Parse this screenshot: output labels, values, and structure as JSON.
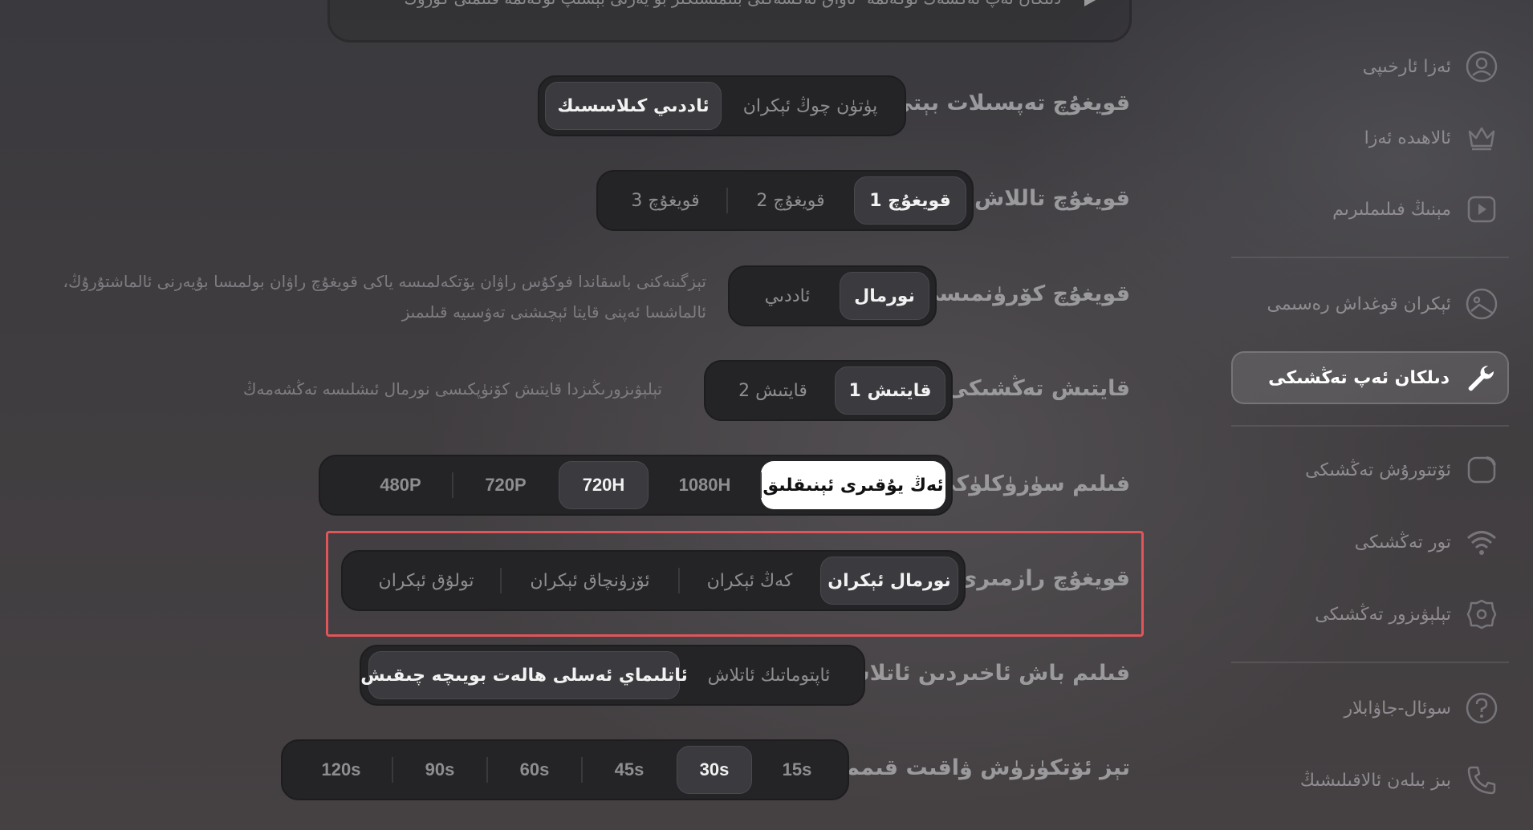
{
  "top": {
    "text": "دىلكان ئەپ تەڭشەك توكەنمە- ئاۋاق تەڭشەكنى بىلمىسىڭىز بو يەرنى بېسىپ توكەنمە قىلمنى كوروك"
  },
  "rows": {
    "subtitle_style": {
      "label": "قويغۇچ تەپسىلات بېتى",
      "options": [
        "پۈتۈن چوڭ ئېكران",
        "ئاددىي كىلاسسىك"
      ]
    },
    "player_select": {
      "label": "قويغۇچ تاللاش",
      "options": [
        "قويغۇچ 1",
        "قويغۇچ 2",
        "قويغۇچ 3"
      ]
    },
    "player_look": {
      "label": "قويغۇچ كۆرۈنمىسى",
      "options": [
        "نورمال",
        "ئاددىي"
      ],
      "note_line1": "تېزگىنەكنى باسقاندا فوكۇس راۋان يۆتكەلمىسە ياكى قويغۇچ راۋان بولمىسا بۇيەرنى ئالماشتۇرۇڭ،",
      "note_line2": "ئالماشسا ئەپنى قايتا ئېچىشنى تەۋسىيە قىلىمىز"
    },
    "decode_setting": {
      "label": "قايتىش تەڭشىكى",
      "options": [
        "قايتىش 1",
        "قايتىش 2"
      ],
      "note": "تېلېۋىزورىڭىزدا قايتىش كۆنۈپكىسى نورمال ئىشلىسە تەڭشەمەڭ"
    },
    "resolution": {
      "label": "فىلىم سۈزۈكلۈكى",
      "options": [
        "ئەڭ يۇقىرى ئېنىقلىق",
        "1080H",
        "720H",
        "720P",
        "480P"
      ]
    },
    "player_ratio": {
      "label": "قويغۇچ رازمىرى",
      "options": [
        "نورمال ئېكران",
        "كەڭ ئېكران",
        "ئۆزۈنچاق ئېكران",
        "تولۇق ئېكران"
      ]
    },
    "start_pos": {
      "label": "فىلىم باش ئاخىردىن ئاتلاش",
      "options": [
        "ئاپتوماتىك ئاتلاش",
        "ئاتلىماي ئەسلى ھالەت بويىچە چىقىش"
      ]
    },
    "fast_forward": {
      "label": "تېز ئۆتكۈزۈش ۋاقىت قىممىتى",
      "options": [
        "15s",
        "30s",
        "45s",
        "60s",
        "90s",
        "120s"
      ]
    }
  },
  "sidebar": {
    "items": [
      {
        "label": "ئەزا ئارخىپى",
        "icon": "user-icon"
      },
      {
        "label": "ئالاھىدە ئەزا",
        "icon": "crown-icon"
      },
      {
        "label": "مېنىڭ فىلىملىرىم",
        "icon": "play-square-icon"
      },
      {
        "label": "ئېكران قوغداش رەسىمى",
        "icon": "image-icon"
      },
      {
        "label": "دىلكان ئەپ تەڭشىكى",
        "icon": "wrench-icon"
      },
      {
        "label": "ئۆتتورۇش تەڭشىكى",
        "icon": "rotate-icon"
      },
      {
        "label": "تور تەڭشىكى",
        "icon": "wifi-icon"
      },
      {
        "label": "تېلېۋىزور تەڭشىكى",
        "icon": "gear-icon"
      },
      {
        "label": "سوئال-جاۋابلار",
        "icon": "question-icon"
      },
      {
        "label": "بىز بىلەن ئالاقىلىشىڭ",
        "icon": "phone-icon"
      }
    ]
  },
  "colors": {
    "highlight": "#e0555a",
    "active_white": "#ffffff"
  }
}
